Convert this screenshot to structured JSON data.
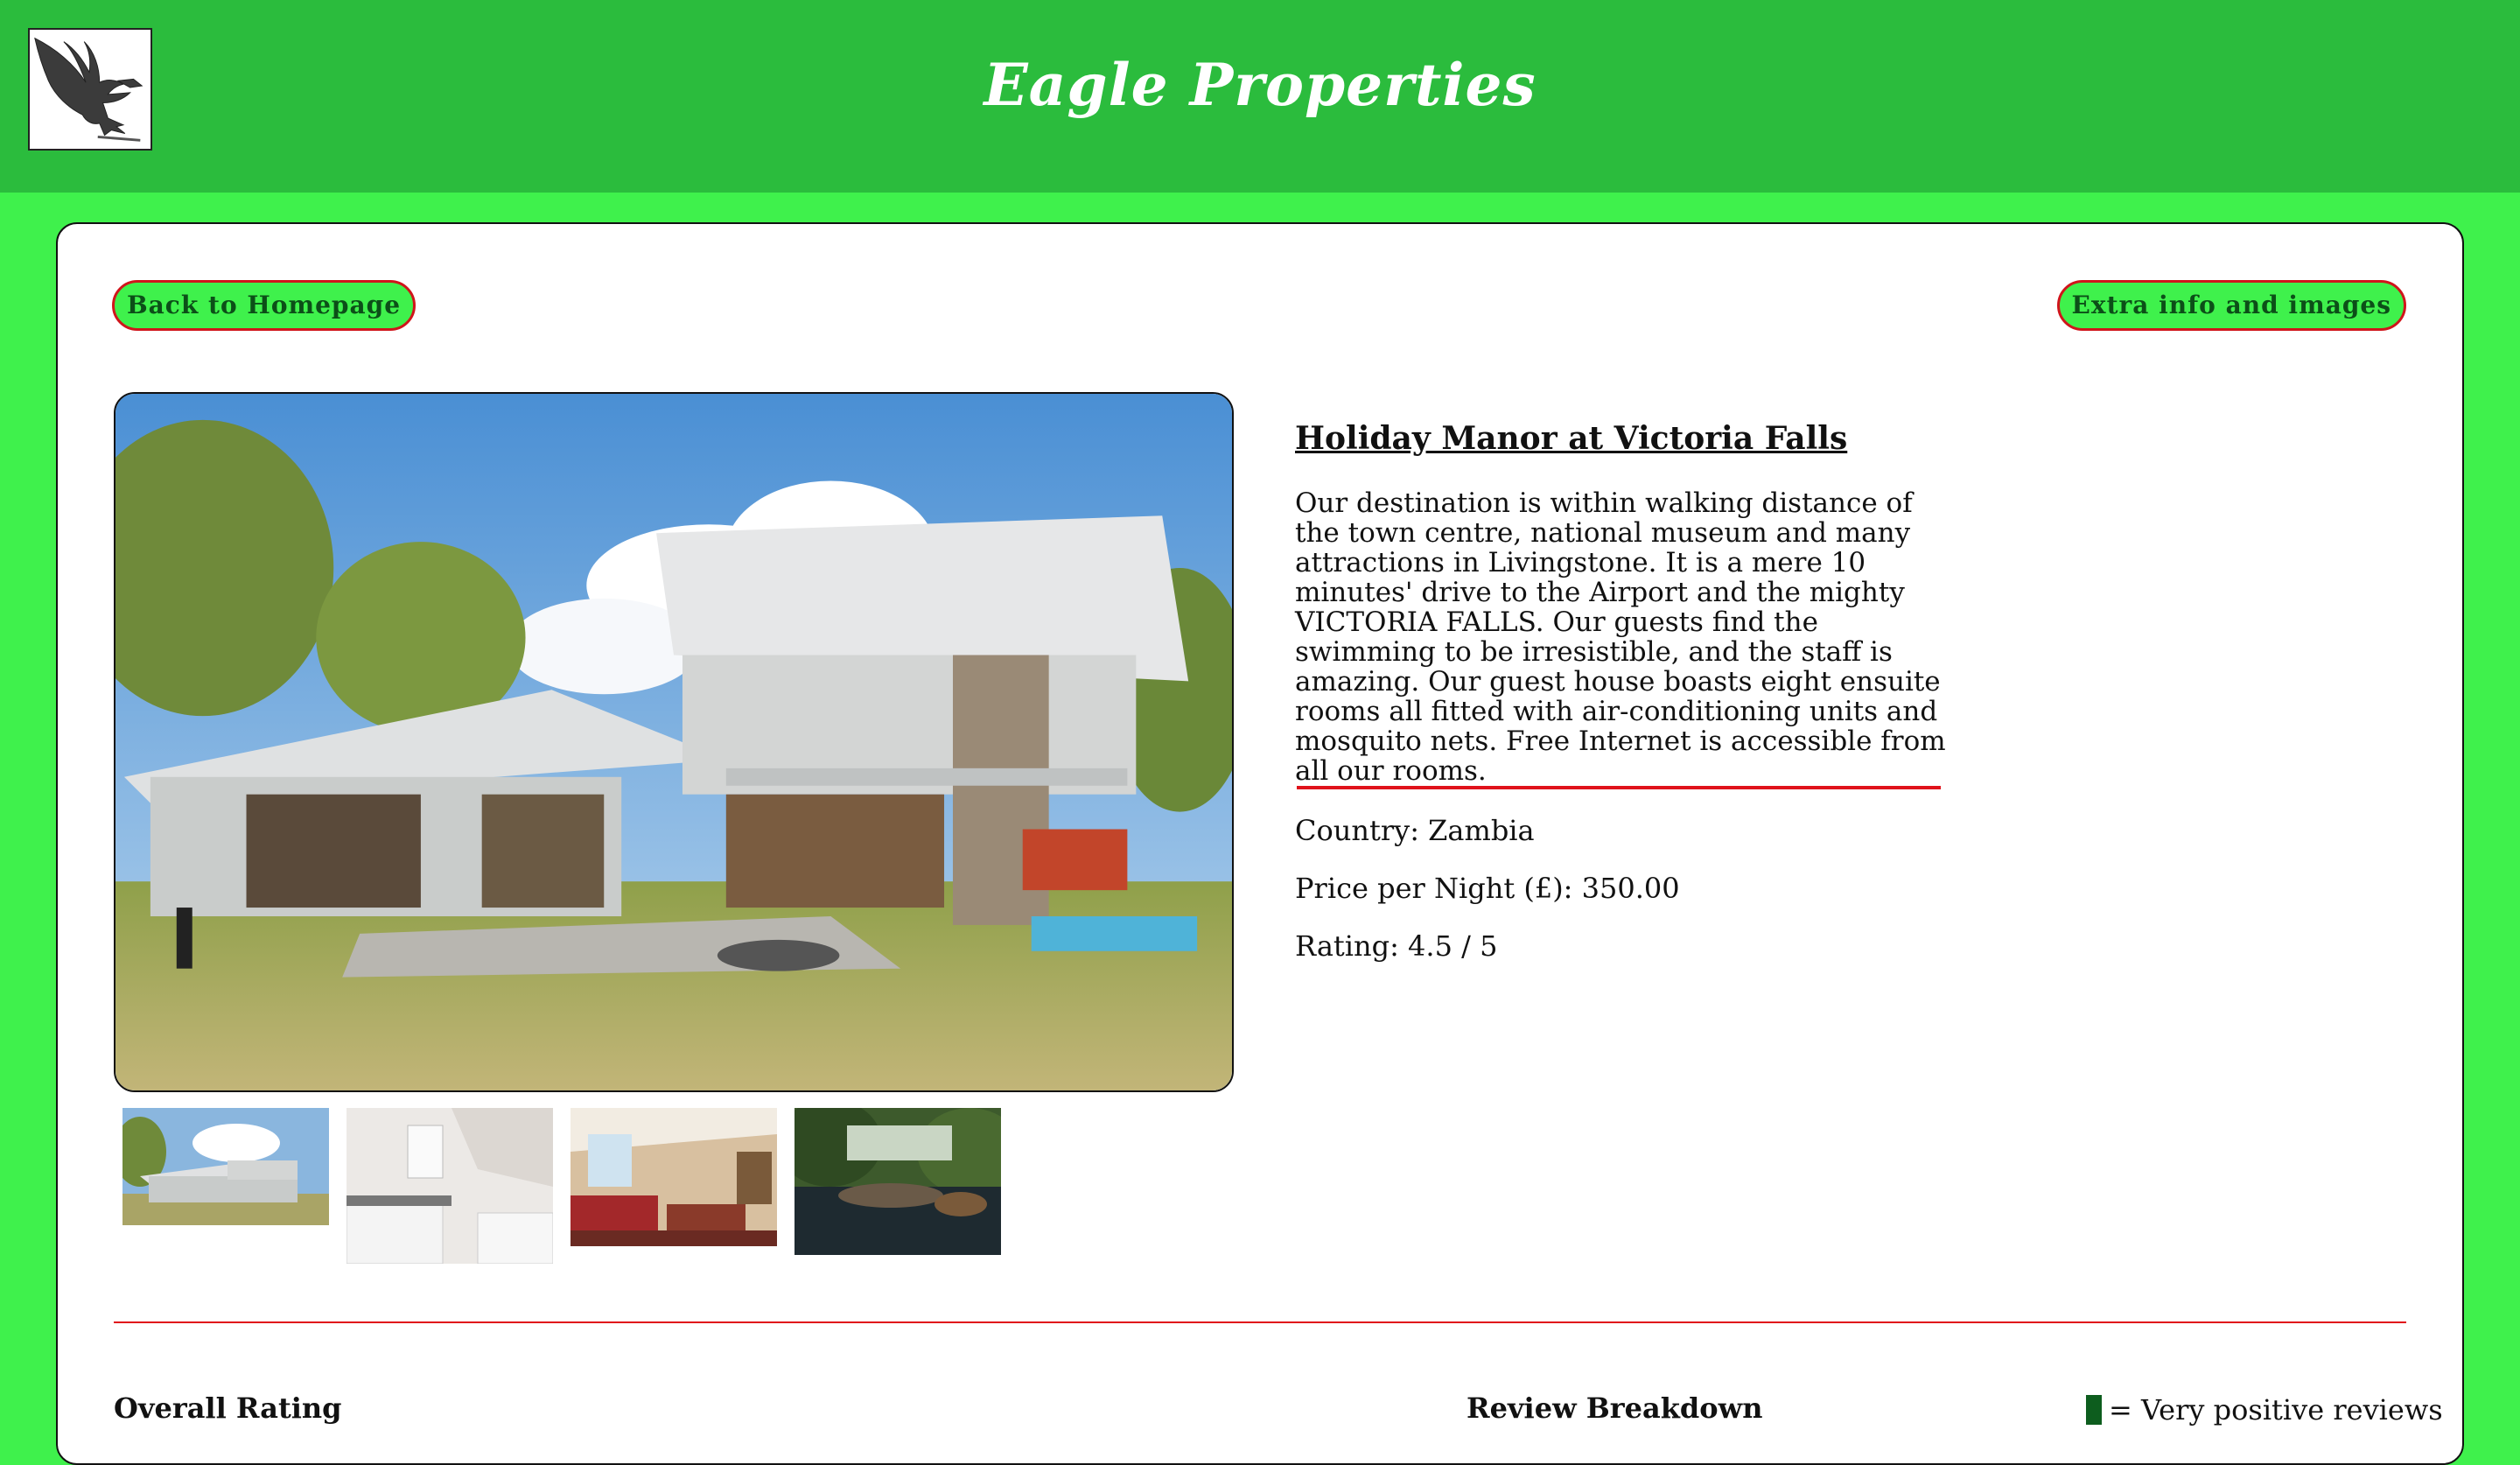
{
  "header": {
    "site_title": "Eagle Properties",
    "logo_icon": "eagle-logo-icon"
  },
  "nav": {
    "back_label": "Back to Homepage",
    "extra_label": "Extra info and images"
  },
  "property": {
    "title": "Holiday Manor at Victoria Falls",
    "description": "Our destination is within walking distance of the town centre, national museum and many attractions in Livingstone. It is a mere 10 minutes' drive to the Airport and the mighty VICTORIA FALLS. Our guests find the swimming to be irresistible, and the staff is amazing. Our guest house boasts eight ensuite rooms all fitted with air-conditioning units and mosquito nets. Free Internet is accessible from all our rooms.",
    "country_line": "Country: Zambia",
    "price_line": "Price per Night (£): 350.00",
    "rating_line": "Rating: 4.5 / 5"
  },
  "gallery": {
    "thumbnails": [
      "house-exterior",
      "bathroom",
      "living-room",
      "pool-garden"
    ]
  },
  "reviews": {
    "overall_heading": "Overall Rating",
    "breakdown_heading": "Review Breakdown",
    "legend_label": "= Very positive reviews"
  },
  "colors": {
    "page_bg": "#3ff14c",
    "header_bg": "#2bbc3d",
    "accent_red": "#e0121b",
    "legend_swatch": "#0d5d1e"
  }
}
